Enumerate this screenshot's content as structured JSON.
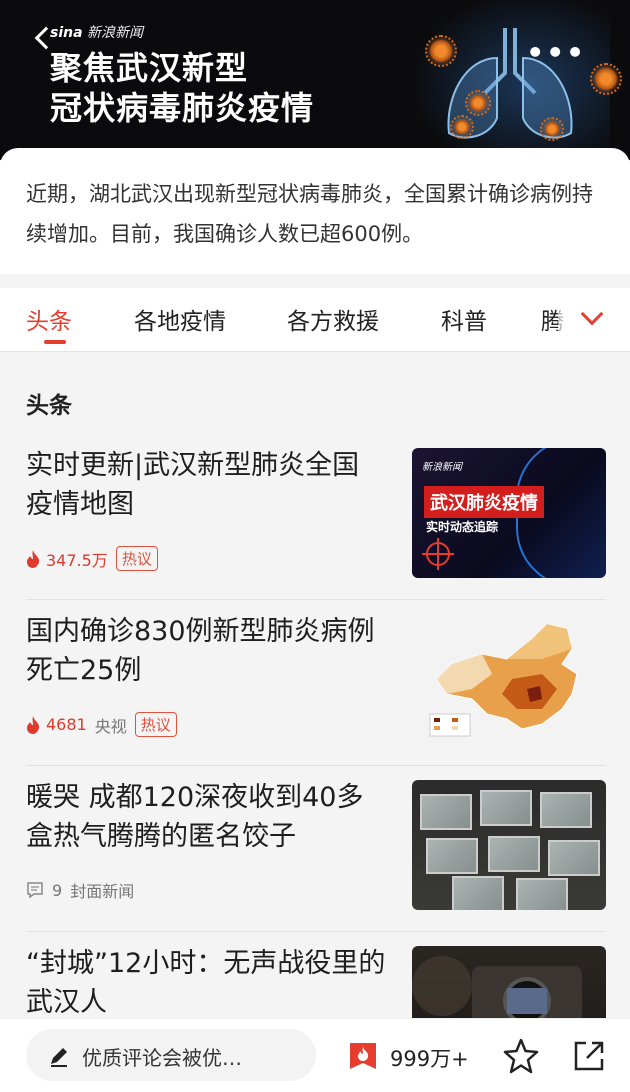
{
  "header": {
    "logo_brand": "sina",
    "logo_text": "新浪新闻",
    "title_line1": "聚焦武汉新型",
    "title_line2": "冠状病毒肺炎疫情"
  },
  "intro": {
    "text": "近期，湖北武汉出现新型冠状病毒肺炎，全国累计确诊病例持续增加。目前，我国确诊人数已超600例。"
  },
  "tabs": [
    {
      "label": "头条",
      "active": true
    },
    {
      "label": "各地疫情"
    },
    {
      "label": "各方救援"
    },
    {
      "label": "科普"
    },
    {
      "label": "腾"
    }
  ],
  "section": {
    "title": "头条"
  },
  "news": [
    {
      "title": "实时更新|武汉新型肺炎全国疫情地图",
      "heat": "347.5万",
      "source": "",
      "badge": "热议",
      "thumb": {
        "logo": "新浪新闻",
        "main": "武汉肺炎疫情",
        "sub": "实时动态追踪"
      }
    },
    {
      "title": "国内确诊830例新型肺炎病例 死亡25例",
      "heat": "4681",
      "source": "央视",
      "badge": "热议"
    },
    {
      "title": "暖哭 成都120深夜收到40多盒热气腾腾的匿名饺子",
      "comments": "9",
      "source": "封面新闻"
    },
    {
      "title": "“封城”12小时：无声战役里的武汉人"
    }
  ],
  "bottombar": {
    "comment_placeholder": "优质评论会被优…",
    "like_count": "999万+"
  },
  "colors": {
    "accent": "#e63d2e",
    "banner_bg": "#0b0b0d"
  }
}
